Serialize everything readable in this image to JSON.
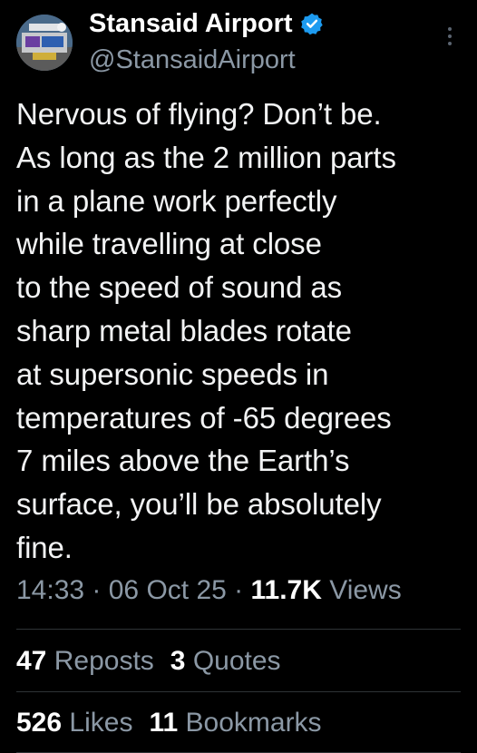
{
  "author": {
    "display_name": "Stansaid Airport",
    "handle": "@StansaidAirport",
    "verified": true,
    "verified_color": "#1d9bf0"
  },
  "tweet": {
    "text": "Nervous of flying? Don’t be.\nAs long as the 2 million parts\nin a plane work perfectly\nwhile travelling at close\nto the speed of sound as\nsharp metal blades rotate\nat supersonic speeds in\ntemperatures of -65 degrees\n7 miles above the Earth’s\nsurface, you’ll be absolutely\nfine."
  },
  "meta": {
    "time": "14:33",
    "separator": " · ",
    "date": "06 Oct 25",
    "views_count": "11.7K",
    "views_label": " Views"
  },
  "stats": {
    "reposts_count": "47",
    "reposts_label": "Reposts",
    "quotes_count": "3",
    "quotes_label": "Quotes",
    "likes_count": "526",
    "likes_label": "Likes",
    "bookmarks_count": "11",
    "bookmarks_label": "Bookmarks"
  },
  "icons": {
    "verified": "verified-badge-icon",
    "more": "more-options-icon"
  },
  "colors": {
    "background": "#000000",
    "text": "#e7e9ea",
    "secondary_text": "#8b98a5",
    "divider": "#2f3336"
  }
}
